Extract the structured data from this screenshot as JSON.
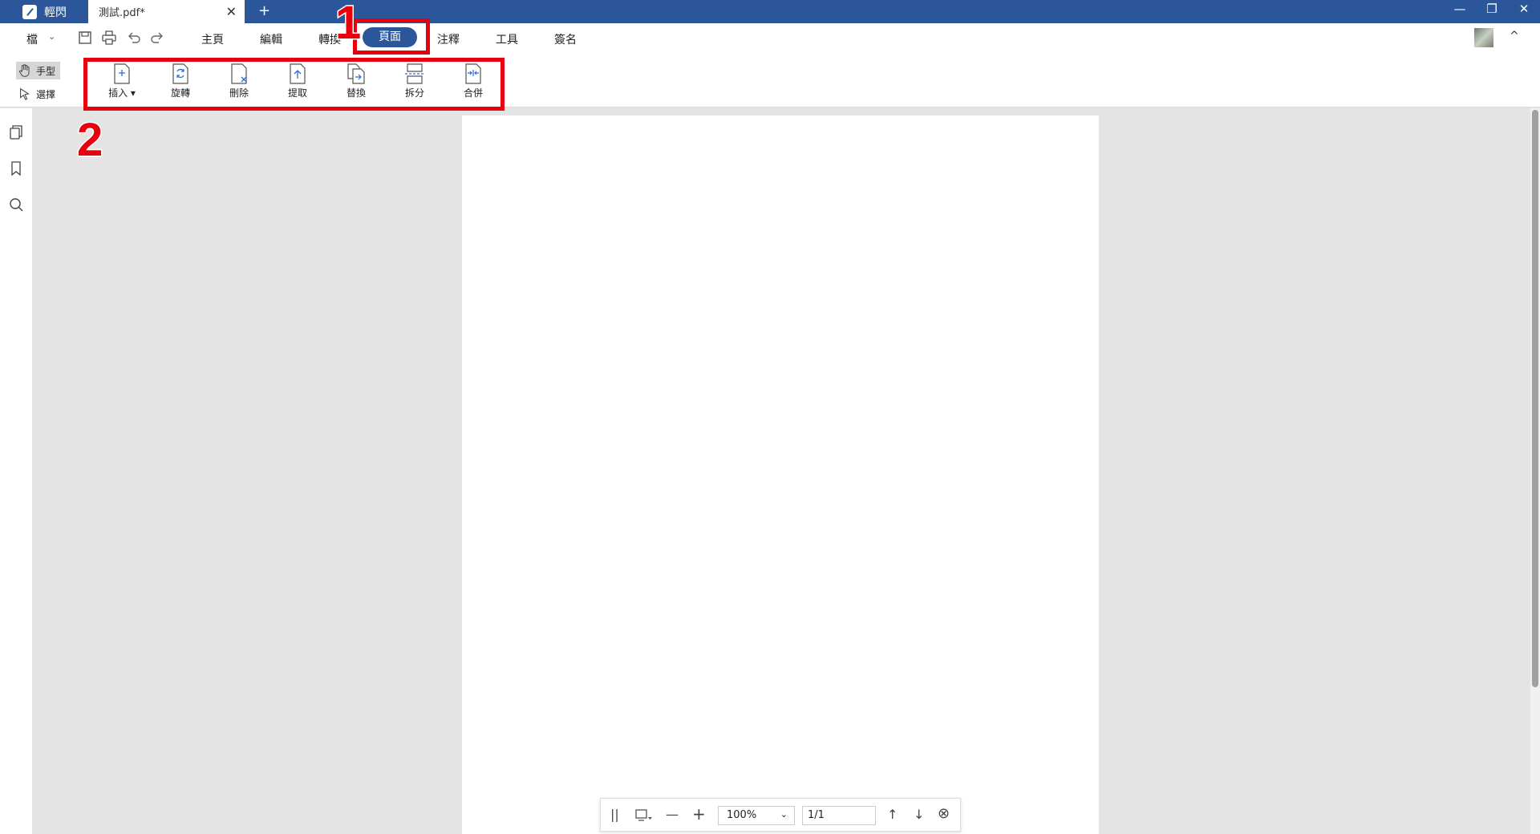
{
  "titlebar": {
    "app_name": "輕閃",
    "doc_tab": "測試.pdf*",
    "close_tab": "✕",
    "new_tab": "+",
    "minimize": "—",
    "restore": "❐",
    "close": "✕",
    "color": "#2b579a"
  },
  "menubar": {
    "file": "檔",
    "file_chevron": "⌄",
    "menus": [
      "主頁",
      "編輯",
      "轉換",
      "頁面",
      "注釋",
      "工具",
      "簽名"
    ],
    "active_menu": "頁面",
    "collapse": "^"
  },
  "ribbon": {
    "modes": [
      "手型",
      "選擇"
    ],
    "tools": [
      {
        "label": "插入 ▾",
        "icon": "insert-page-icon"
      },
      {
        "label": "旋轉",
        "icon": "rotate-page-icon"
      },
      {
        "label": "刪除",
        "icon": "delete-page-icon"
      },
      {
        "label": "提取",
        "icon": "extract-page-icon"
      },
      {
        "label": "替換",
        "icon": "replace-page-icon"
      },
      {
        "label": "拆分",
        "icon": "split-page-icon"
      },
      {
        "label": "合併",
        "icon": "merge-page-icon"
      }
    ]
  },
  "sidebar": {
    "icons": [
      "pages-icon",
      "bookmark-icon",
      "search-icon"
    ]
  },
  "zoombar": {
    "divider": "||",
    "zoom_out": "—",
    "zoom_in": "+",
    "zoom": "100%",
    "zoom_chevron": "⌄",
    "page": "1/1",
    "prev": "↑",
    "next": "↓",
    "close": "⊗"
  },
  "annotations": {
    "step1": "1",
    "step2": "2",
    "color": "#e8000f"
  }
}
